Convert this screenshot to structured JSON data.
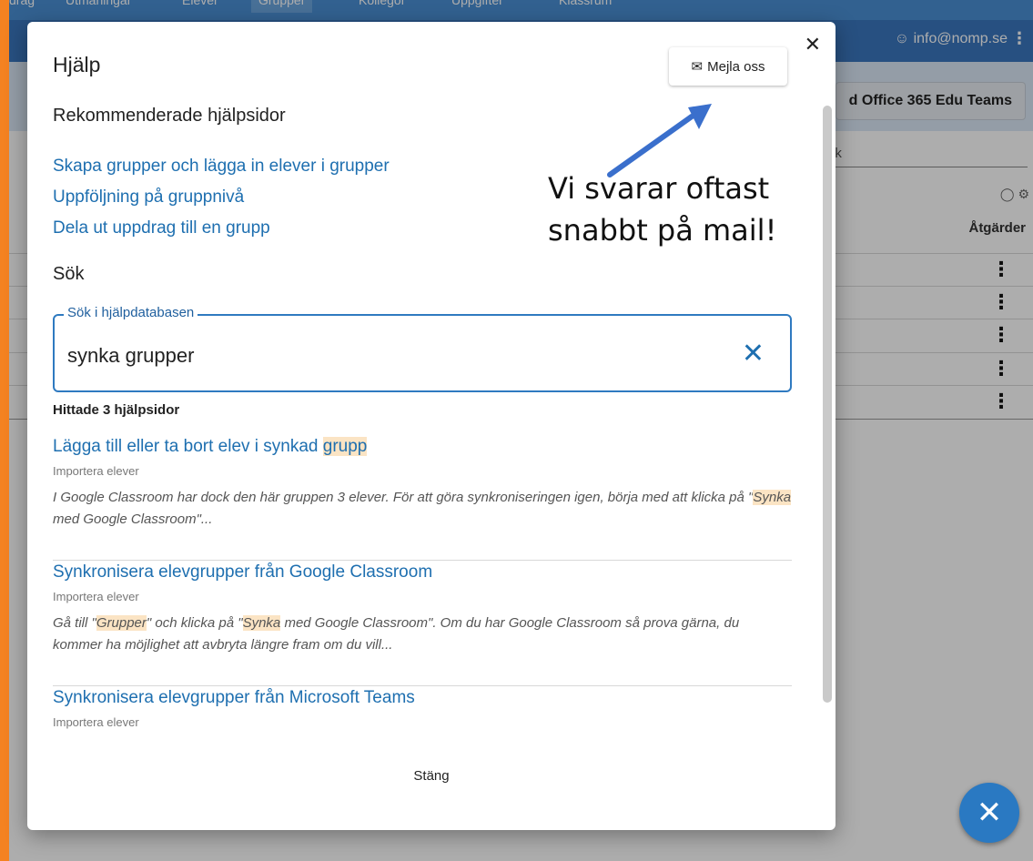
{
  "background_app": {
    "top_nav": [
      "drag",
      "Utmaningar",
      "Elever",
      "Grupper",
      "Kollegor",
      "Uppgifter",
      "Klassrum"
    ],
    "user_email": "info@nomp.se",
    "teams_button_label": "d Office 365 Edu Teams",
    "search_placeholder": "ök",
    "actions_header": "Åtgärder"
  },
  "modal": {
    "title": "Hjälp",
    "mail_button_label": "Mejla oss",
    "recommended_heading": "Rekommenderade hjälpsidor",
    "recommended_links": [
      "Skapa grupper och lägga in elever i grupper",
      "Uppföljning på gruppnivå",
      "Dela ut uppdrag till en grupp"
    ],
    "search_heading": "Sök",
    "search_legend": "Sök i hjälpdatabasen",
    "search_value": "synka grupper",
    "found_label": "Hittade 3 hjälpsidor",
    "results": [
      {
        "title_before": "Lägga till eller ta bort elev i synkad ",
        "title_mark": "grupp",
        "category": "Importera elever",
        "snippet_1": "I Google Classroom har dock den här gruppen 3 elever. För att göra synkroniseringen igen, börja med att klicka på \"",
        "snippet_mark_1": "Synka",
        "snippet_2": " med Google Classroom\"..."
      },
      {
        "title": "Synkronisera elevgrupper från Google Classroom",
        "category": "Importera elever",
        "snippet_1": "Gå till \"",
        "snippet_mark_1": "Grupper",
        "snippet_2": "\" och klicka på \"",
        "snippet_mark_2": "Synka",
        "snippet_3": " med Google Classroom\". Om du har Google Classroom så prova gärna, du kommer ha möjlighet att avbryta längre fram om du vill..."
      },
      {
        "title": "Synkronisera elevgrupper från Microsoft Teams",
        "category": "Importera elever"
      }
    ],
    "footer_close_label": "Stäng"
  },
  "annotation": {
    "text": "Vi svarar oftast snabbt på mail!"
  },
  "colors": {
    "frame_orange": "#f48221",
    "link_blue": "#1e6fb0",
    "fab_blue": "#2a79c2",
    "highlight": "#fbe4c4"
  }
}
